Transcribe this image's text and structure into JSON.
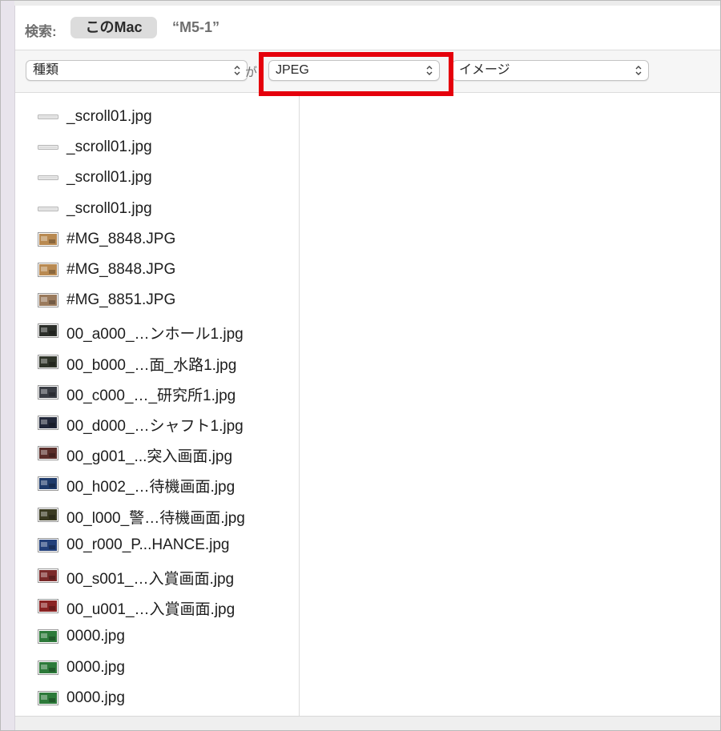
{
  "search": {
    "label": "検索:",
    "scope_button": "このMac",
    "scope_folder": "“M5-1”"
  },
  "criteria": {
    "attribute": "種類",
    "connector": "が",
    "kind_value": "JPEG",
    "type_value": "イメージ"
  },
  "accent": {
    "highlight": "#e5000c"
  },
  "files": [
    {
      "name": "_scroll01.jpg",
      "icon": "blank-strip-thumbnail-icon",
      "thumb": "#d8d8d8"
    },
    {
      "name": "_scroll01.jpg",
      "icon": "blank-strip-thumbnail-icon",
      "thumb": "#d8d8d8"
    },
    {
      "name": "_scroll01.jpg",
      "icon": "blank-strip-thumbnail-icon",
      "thumb": "#d8d8d8"
    },
    {
      "name": "_scroll01.jpg",
      "icon": "blank-strip-thumbnail-icon",
      "thumb": "#d8d8d8"
    },
    {
      "name": "#MG_8848.JPG",
      "icon": "photo-thumbnail-icon",
      "thumb": "#b98a52"
    },
    {
      "name": "#MG_8848.JPG",
      "icon": "photo-thumbnail-icon",
      "thumb": "#b98a52"
    },
    {
      "name": "#MG_8851.JPG",
      "icon": "photo-thumbnail-icon",
      "thumb": "#9a7a5c"
    },
    {
      "name": "00_a000_…ンホール1.jpg",
      "icon": "dark-image-thumbnail-icon",
      "thumb": "#2c2f2a"
    },
    {
      "name": "00_b000_…面_水路1.jpg",
      "icon": "dark-image-thumbnail-icon",
      "thumb": "#30352a"
    },
    {
      "name": "00_c000_…_研究所1.jpg",
      "icon": "dark-image-thumbnail-icon",
      "thumb": "#3a3d44"
    },
    {
      "name": "00_d000_…シャフト1.jpg",
      "icon": "dark-image-thumbnail-icon",
      "thumb": "#22283a"
    },
    {
      "name": "00_g001_...突入画面.jpg",
      "icon": "dark-image-thumbnail-icon",
      "thumb": "#5a2e2a"
    },
    {
      "name": "00_h002_…待機画面.jpg",
      "icon": "dark-image-thumbnail-icon",
      "thumb": "#1e3a6a"
    },
    {
      "name": "00_l000_警…待機画面.jpg",
      "icon": "dark-image-thumbnail-icon",
      "thumb": "#3a3a22"
    },
    {
      "name": "00_r000_P...HANCE.jpg",
      "icon": "dark-image-thumbnail-icon",
      "thumb": "#23407a"
    },
    {
      "name": "00_s001_…入賞画面.jpg",
      "icon": "dark-image-thumbnail-icon",
      "thumb": "#7a2a2a"
    },
    {
      "name": "00_u001_…入賞画面.jpg",
      "icon": "dark-image-thumbnail-icon",
      "thumb": "#8a2424"
    },
    {
      "name": "0000.jpg",
      "icon": "colorful-image-thumbnail-icon",
      "thumb": "#2d7a3a"
    },
    {
      "name": "0000.jpg",
      "icon": "colorful-image-thumbnail-icon",
      "thumb": "#2d7a3a"
    },
    {
      "name": "0000.jpg",
      "icon": "colorful-image-thumbnail-icon",
      "thumb": "#2d7a3a"
    }
  ]
}
